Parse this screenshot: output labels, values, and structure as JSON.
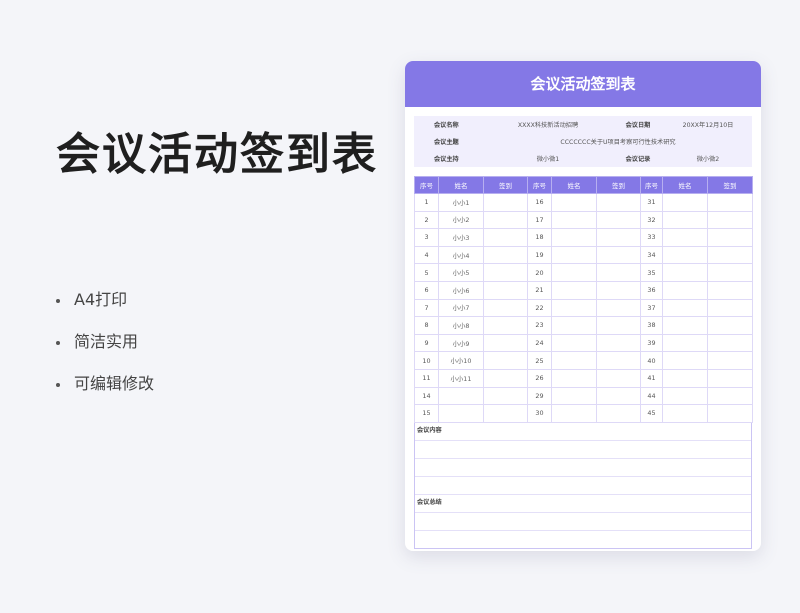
{
  "promo": {
    "title": "会议活动签到表",
    "features": [
      "A4打印",
      "简洁实用",
      "可编辑修改"
    ]
  },
  "sheet": {
    "header": "会议活动签到表",
    "meta": {
      "name_label": "会议名称",
      "name_value": "XXXX科技新活动招聘",
      "date_label": "会议日期",
      "date_value": "20XX年12月10日",
      "topic_label": "会议主题",
      "topic_value": "CCCCCCC关于U项目考察可行性技术研究",
      "host_label": "会议主持",
      "host_value": "微小微1",
      "recorder_label": "会议记录",
      "recorder_value": "微小微2"
    },
    "columns": [
      "序号",
      "姓名",
      "签到",
      "序号",
      "姓名",
      "签到",
      "序号",
      "姓名",
      "签到"
    ],
    "rows": [
      [
        "1",
        "小小1",
        "",
        "16",
        "",
        "",
        "31",
        "",
        ""
      ],
      [
        "2",
        "小小2",
        "",
        "17",
        "",
        "",
        "32",
        "",
        ""
      ],
      [
        "3",
        "小小3",
        "",
        "18",
        "",
        "",
        "33",
        "",
        ""
      ],
      [
        "4",
        "小小4",
        "",
        "19",
        "",
        "",
        "34",
        "",
        ""
      ],
      [
        "5",
        "小小5",
        "",
        "20",
        "",
        "",
        "35",
        "",
        ""
      ],
      [
        "6",
        "小小6",
        "",
        "21",
        "",
        "",
        "36",
        "",
        ""
      ],
      [
        "7",
        "小小7",
        "",
        "22",
        "",
        "",
        "37",
        "",
        ""
      ],
      [
        "8",
        "小小8",
        "",
        "23",
        "",
        "",
        "38",
        "",
        ""
      ],
      [
        "9",
        "小小9",
        "",
        "24",
        "",
        "",
        "39",
        "",
        ""
      ],
      [
        "10",
        "小小10",
        "",
        "25",
        "",
        "",
        "40",
        "",
        ""
      ],
      [
        "11",
        "小小11",
        "",
        "26",
        "",
        "",
        "41",
        "",
        ""
      ],
      [
        "14",
        "",
        "",
        "29",
        "",
        "",
        "44",
        "",
        ""
      ],
      [
        "15",
        "",
        "",
        "30",
        "",
        "",
        "45",
        "",
        ""
      ]
    ],
    "content_label": "会议内容",
    "summary_label": "会议总结"
  }
}
